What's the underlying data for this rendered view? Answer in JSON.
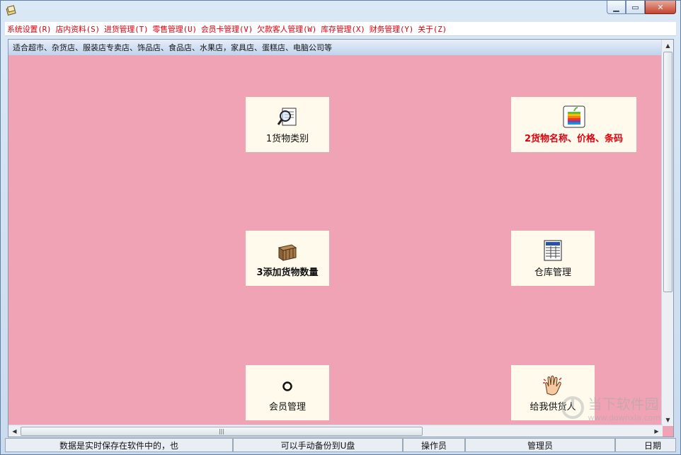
{
  "menubar": {
    "items": [
      "系统设置(R)",
      "店内资料(S)",
      "进货管理(T)",
      "零售管理(U)",
      "会员卡管理(V)",
      "欠款客人管理(W)",
      "库存管理(X)",
      "财务管理(Y)",
      "关于(Z)"
    ]
  },
  "info_bar": {
    "text": "适合超市、杂货店、服装店专卖店、饰品店、食品店、水果店，家具店、蛋糕店、电脑公司等"
  },
  "tiles": [
    {
      "label": "1货物类别",
      "icon": "magnifier-document-icon",
      "style": "normal"
    },
    {
      "label": "2货物名称、价格、条码",
      "icon": "apple-logo-icon",
      "style": "red"
    },
    {
      "label": "3添加货物数量",
      "icon": "wooden-crate-icon",
      "style": "bold"
    },
    {
      "label": "仓库管理",
      "icon": "spreadsheet-document-icon",
      "style": "normal"
    },
    {
      "label": "会员管理",
      "icon": "ring-icon",
      "style": "normal"
    },
    {
      "label": "给我供货人",
      "icon": "waving-hand-icon",
      "style": "normal"
    }
  ],
  "statusbar": {
    "cells": [
      "数据是实时保存在软件中的，也",
      "可以手动备份到U盘",
      "操作员",
      "管理员",
      "日期"
    ]
  },
  "watermark": {
    "name": "当下软件园",
    "url": "www.downxia.com"
  },
  "colors": {
    "menu_text": "#e0000e",
    "client_bg": "#f0a3b4",
    "tile_bg": "#fffaec",
    "highlight_label": "#e0000e"
  }
}
